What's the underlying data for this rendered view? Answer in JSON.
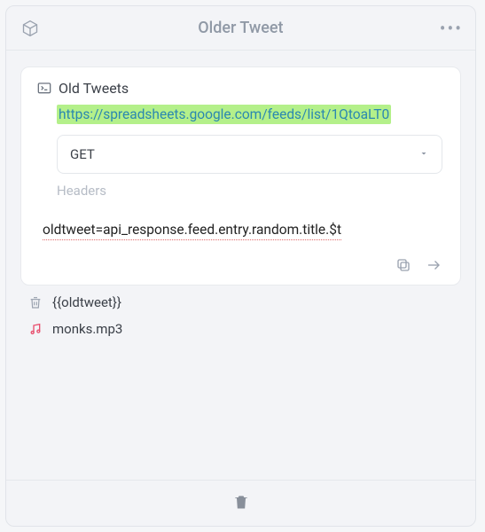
{
  "header": {
    "title": "Older Tweet"
  },
  "card": {
    "title": "Old Tweets",
    "url": "https://spreadsheets.google.com/feeds/list/1QtoaLT0",
    "method": "GET",
    "headers_placeholder": "Headers",
    "expression": "oldtweet=api_response.feed.entry.random.title.$t"
  },
  "rows": {
    "template_var": "{{oldtweet}}",
    "audio_file": "monks.mp3"
  }
}
